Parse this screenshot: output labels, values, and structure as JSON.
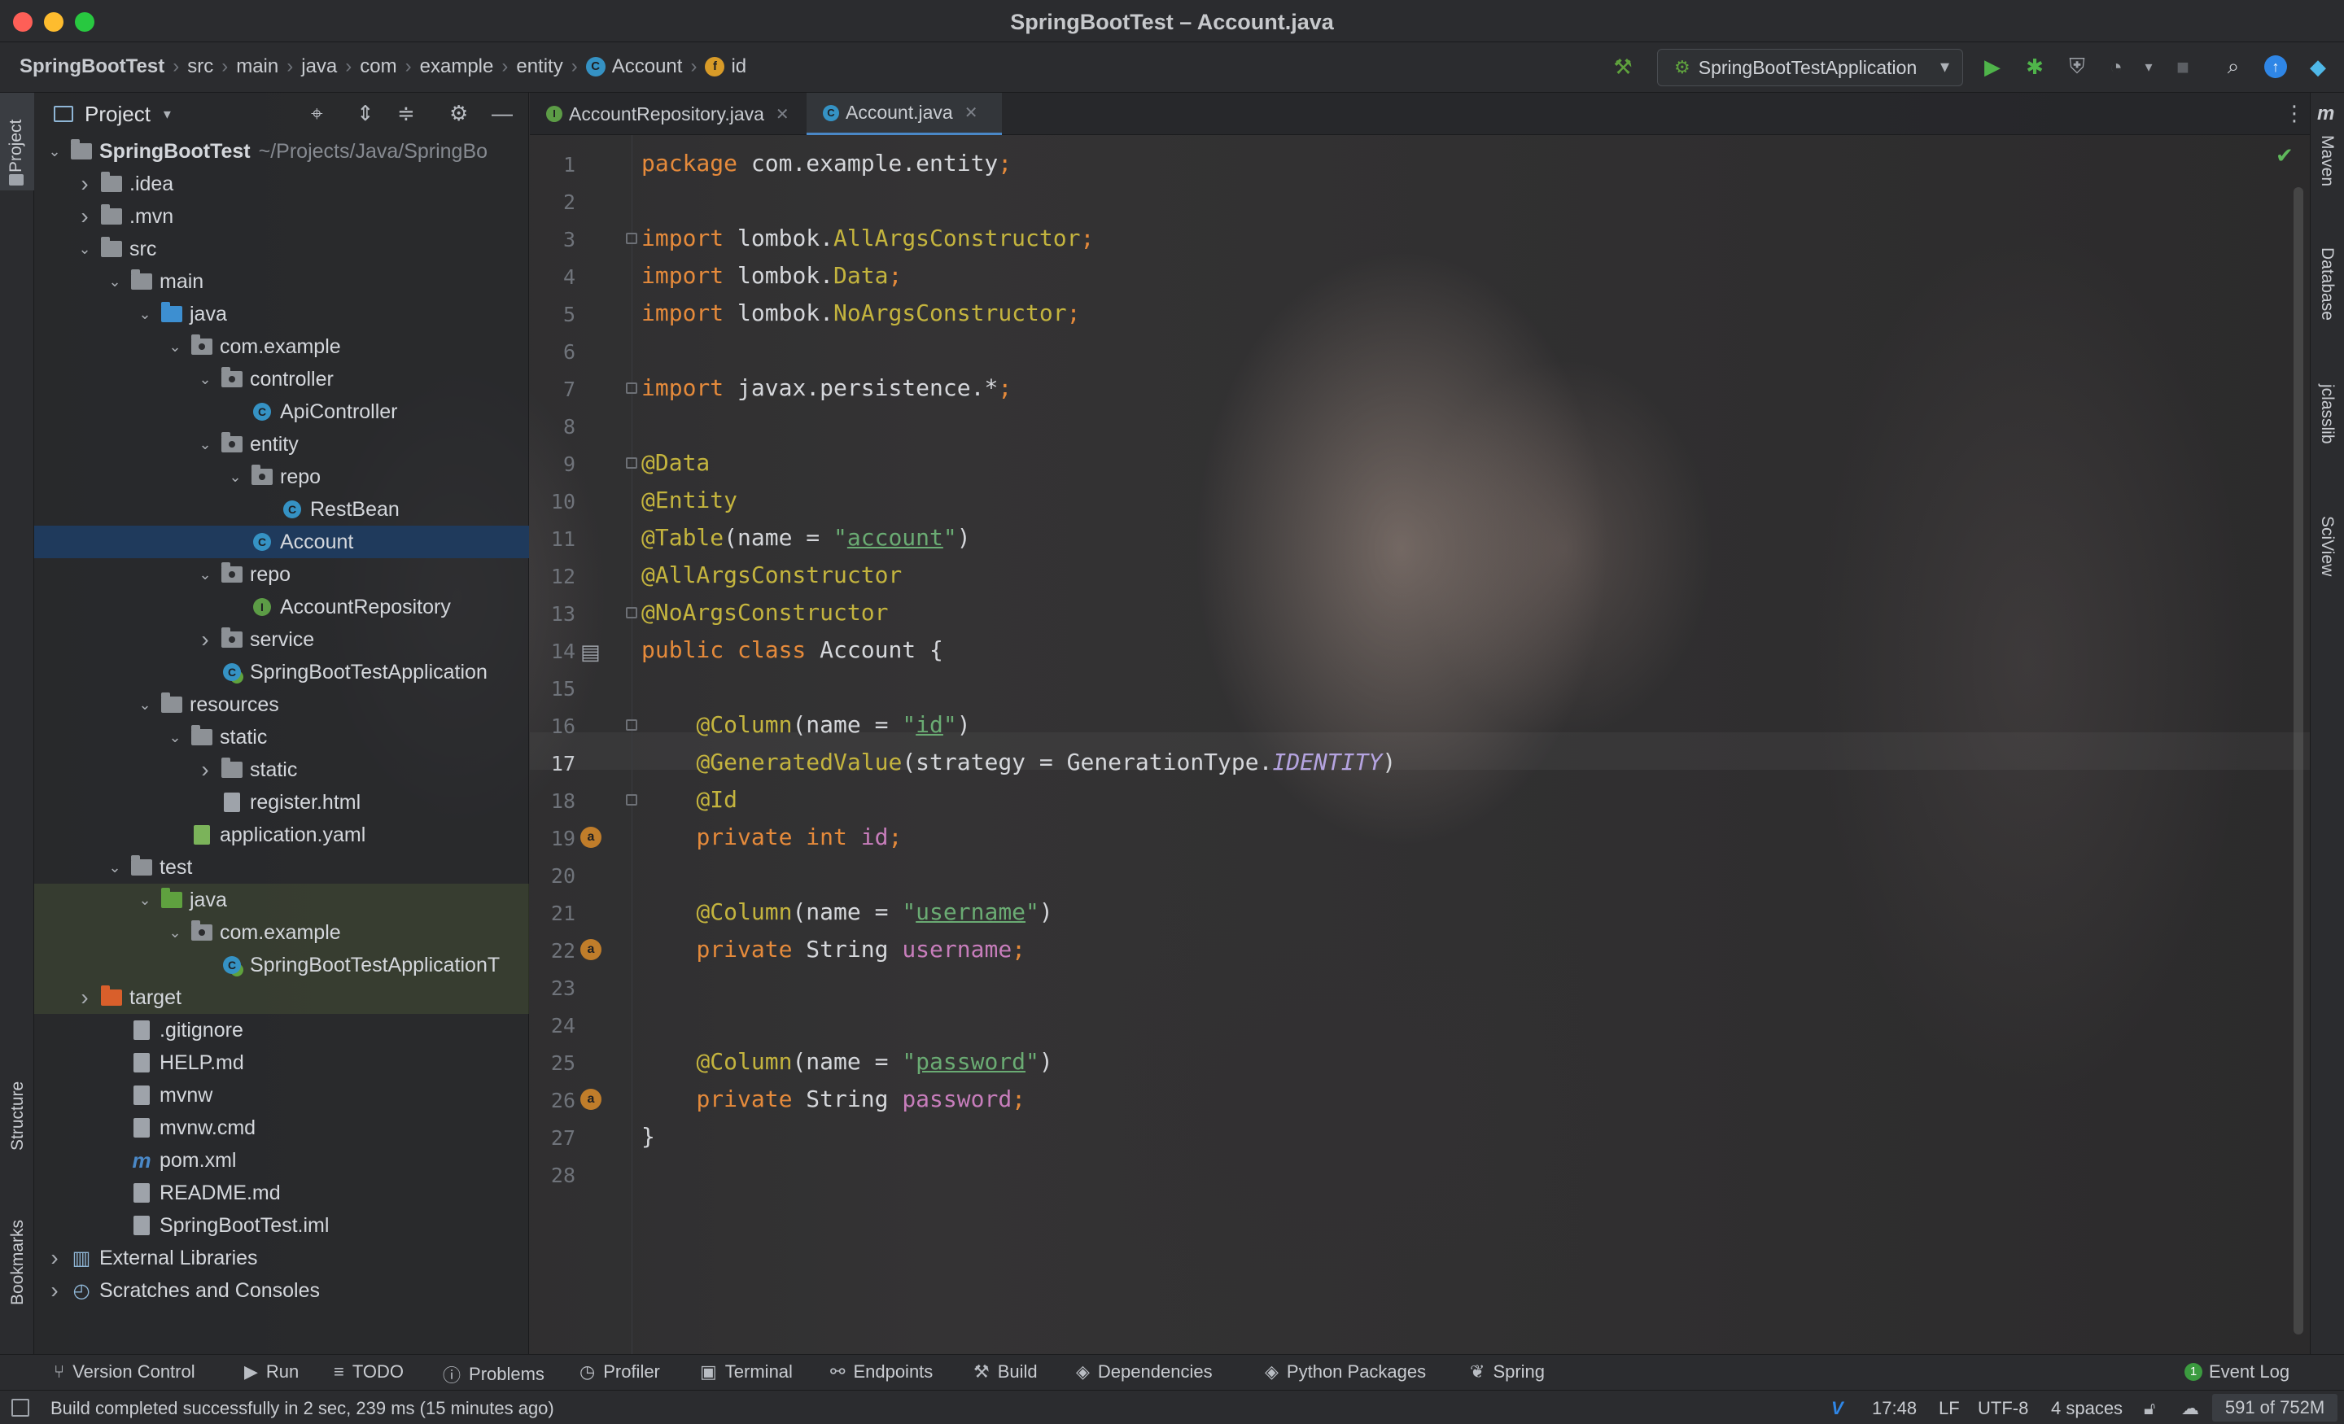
{
  "window": {
    "title": "SpringBootTest – Account.java"
  },
  "breadcrumb": [
    "SpringBootTest",
    "src",
    "main",
    "java",
    "com",
    "example",
    "entity",
    "Account",
    "id"
  ],
  "toolbar": {
    "run_config": "SpringBootTestApplication"
  },
  "left_stripe": {
    "project": "Project",
    "structure": "Structure",
    "bookmarks": "Bookmarks"
  },
  "right_stripe": {
    "maven": "Maven",
    "database": "Database",
    "jclasslib": "jclasslib",
    "sciview": "SciView"
  },
  "project_panel": {
    "title": "Project",
    "tree": [
      {
        "label": "SpringBootTest",
        "hint": "~/Projects/Java/SpringBo",
        "depth": 0,
        "arrow": "v",
        "icon": "folder",
        "bold": true
      },
      {
        "label": ".idea",
        "depth": 1,
        "arrow": ">",
        "icon": "folder"
      },
      {
        "label": ".mvn",
        "depth": 1,
        "arrow": ">",
        "icon": "folder"
      },
      {
        "label": "src",
        "depth": 1,
        "arrow": "v",
        "icon": "folder"
      },
      {
        "label": "main",
        "depth": 2,
        "arrow": "v",
        "icon": "folder"
      },
      {
        "label": "java",
        "depth": 3,
        "arrow": "v",
        "icon": "folder-blue"
      },
      {
        "label": "com.example",
        "depth": 4,
        "arrow": "v",
        "icon": "package"
      },
      {
        "label": "controller",
        "depth": 5,
        "arrow": "v",
        "icon": "package"
      },
      {
        "label": "ApiController",
        "depth": 6,
        "arrow": "",
        "icon": "class"
      },
      {
        "label": "entity",
        "depth": 5,
        "arrow": "v",
        "icon": "package"
      },
      {
        "label": "repo",
        "depth": 6,
        "arrow": "v",
        "icon": "package"
      },
      {
        "label": "RestBean",
        "depth": 7,
        "arrow": "",
        "icon": "class"
      },
      {
        "label": "Account",
        "depth": 6,
        "arrow": "",
        "icon": "class",
        "selected": true
      },
      {
        "label": "repo",
        "depth": 5,
        "arrow": "v",
        "icon": "package"
      },
      {
        "label": "AccountRepository",
        "depth": 6,
        "arrow": "",
        "icon": "interface"
      },
      {
        "label": "service",
        "depth": 5,
        "arrow": ">",
        "icon": "package"
      },
      {
        "label": "SpringBootTestApplication",
        "depth": 5,
        "arrow": "",
        "icon": "spring-class"
      },
      {
        "label": "resources",
        "depth": 3,
        "arrow": "v",
        "icon": "folder"
      },
      {
        "label": "static",
        "depth": 4,
        "arrow": "v",
        "icon": "folder"
      },
      {
        "label": "static",
        "depth": 5,
        "arrow": ">",
        "icon": "folder"
      },
      {
        "label": "register.html",
        "depth": 5,
        "arrow": "",
        "icon": "file"
      },
      {
        "label": "application.yaml",
        "depth": 4,
        "arrow": "",
        "icon": "file-yaml"
      },
      {
        "label": "test",
        "depth": 2,
        "arrow": "v",
        "icon": "folder"
      },
      {
        "label": "java",
        "depth": 3,
        "arrow": "v",
        "icon": "folder-green",
        "test": true
      },
      {
        "label": "com.example",
        "depth": 4,
        "arrow": "v",
        "icon": "package",
        "test": true
      },
      {
        "label": "SpringBootTestApplicationT",
        "depth": 5,
        "arrow": "",
        "icon": "spring-class",
        "test": true
      },
      {
        "label": "target",
        "depth": 1,
        "arrow": ">",
        "icon": "folder-orange",
        "test": true
      },
      {
        "label": ".gitignore",
        "depth": 2,
        "arrow": "",
        "icon": "file"
      },
      {
        "label": "HELP.md",
        "depth": 2,
        "arrow": "",
        "icon": "file"
      },
      {
        "label": "mvnw",
        "depth": 2,
        "arrow": "",
        "icon": "file"
      },
      {
        "label": "mvnw.cmd",
        "depth": 2,
        "arrow": "",
        "icon": "file"
      },
      {
        "label": "pom.xml",
        "depth": 2,
        "arrow": "",
        "icon": "file-maven"
      },
      {
        "label": "README.md",
        "depth": 2,
        "arrow": "",
        "icon": "file"
      },
      {
        "label": "SpringBootTest.iml",
        "depth": 2,
        "arrow": "",
        "icon": "file"
      },
      {
        "label": "External Libraries",
        "depth": 0,
        "arrow": ">",
        "icon": "libraries"
      },
      {
        "label": "Scratches and Consoles",
        "depth": 0,
        "arrow": ">",
        "icon": "scratches"
      }
    ]
  },
  "editor": {
    "tabs": [
      {
        "label": "AccountRepository.java",
        "icon": "interface",
        "active": false
      },
      {
        "label": "Account.java",
        "icon": "class",
        "active": true
      }
    ],
    "current_line": 17,
    "lines": [
      [
        [
          "kw",
          "package "
        ],
        [
          "",
          "com.example.entity"
        ],
        [
          "kw",
          ";"
        ]
      ],
      [],
      [
        [
          "kw",
          "import "
        ],
        [
          "",
          "lombok."
        ],
        [
          "an",
          "AllArgsConstructor"
        ],
        [
          "kw",
          ";"
        ]
      ],
      [
        [
          "kw",
          "import "
        ],
        [
          "",
          "lombok."
        ],
        [
          "an",
          "Data"
        ],
        [
          "kw",
          ";"
        ]
      ],
      [
        [
          "kw",
          "import "
        ],
        [
          "",
          "lombok."
        ],
        [
          "an",
          "NoArgsConstructor"
        ],
        [
          "kw",
          ";"
        ]
      ],
      [],
      [
        [
          "kw",
          "import "
        ],
        [
          "",
          "javax.persistence.*"
        ],
        [
          "kw",
          ";"
        ]
      ],
      [],
      [
        [
          "an",
          "@Data"
        ]
      ],
      [
        [
          "an",
          "@Entity"
        ]
      ],
      [
        [
          "an",
          "@Table"
        ],
        [
          "",
          "(name = "
        ],
        [
          "str",
          "\""
        ],
        [
          "stru",
          "account"
        ],
        [
          "str",
          "\""
        ],
        [
          "",
          ")"
        ]
      ],
      [
        [
          "an",
          "@AllArgsConstructor"
        ]
      ],
      [
        [
          "an",
          "@NoArgsConstructor"
        ]
      ],
      [
        [
          "kw",
          "public class "
        ],
        [
          "",
          "Account {"
        ]
      ],
      [],
      [
        [
          "",
          "    "
        ],
        [
          "an",
          "@Column"
        ],
        [
          "",
          "(name = "
        ],
        [
          "str",
          "\""
        ],
        [
          "stru",
          "id"
        ],
        [
          "str",
          "\""
        ],
        [
          "",
          ")"
        ]
      ],
      [
        [
          "",
          "    "
        ],
        [
          "an",
          "@GeneratedValue"
        ],
        [
          "",
          "(strategy = GenerationType."
        ],
        [
          "it",
          "IDENTITY"
        ],
        [
          "",
          ")"
        ]
      ],
      [
        [
          "",
          "    "
        ],
        [
          "an",
          "@Id"
        ]
      ],
      [
        [
          "",
          "    "
        ],
        [
          "kw",
          "private int "
        ],
        [
          "fld",
          "id"
        ],
        [
          "kw",
          ";"
        ]
      ],
      [],
      [
        [
          "",
          "    "
        ],
        [
          "an",
          "@Column"
        ],
        [
          "",
          "(name = "
        ],
        [
          "str",
          "\""
        ],
        [
          "stru",
          "username"
        ],
        [
          "str",
          "\""
        ],
        [
          "",
          ")"
        ]
      ],
      [
        [
          "",
          "    "
        ],
        [
          "kw",
          "private "
        ],
        [
          "",
          "String "
        ],
        [
          "fld",
          "username"
        ],
        [
          "kw",
          ";"
        ]
      ],
      [],
      [],
      [
        [
          "",
          "    "
        ],
        [
          "an",
          "@Column"
        ],
        [
          "",
          "(name = "
        ],
        [
          "str",
          "\""
        ],
        [
          "stru",
          "password"
        ],
        [
          "str",
          "\""
        ],
        [
          "",
          ")"
        ]
      ],
      [
        [
          "",
          "    "
        ],
        [
          "kw",
          "private "
        ],
        [
          "",
          "String "
        ],
        [
          "fld",
          "password"
        ],
        [
          "kw",
          ";"
        ]
      ],
      [
        [
          "",
          "}"
        ]
      ],
      []
    ],
    "gutter_marks": [
      {
        "line": 14,
        "symbol": "db-icon"
      },
      {
        "line": 19,
        "symbol": "a"
      },
      {
        "line": 22,
        "symbol": "a"
      },
      {
        "line": 26,
        "symbol": "a"
      }
    ]
  },
  "tool_windows": [
    {
      "label": "Version Control",
      "icon": "branch-icon"
    },
    {
      "label": "Run",
      "icon": "play-icon"
    },
    {
      "label": "TODO",
      "icon": "list-icon"
    },
    {
      "label": "Problems",
      "icon": "info-icon"
    },
    {
      "label": "Profiler",
      "icon": "profiler-icon"
    },
    {
      "label": "Terminal",
      "icon": "terminal-icon"
    },
    {
      "label": "Endpoints",
      "icon": "endpoints-icon"
    },
    {
      "label": "Build",
      "icon": "hammer-icon"
    },
    {
      "label": "Dependencies",
      "icon": "layers-icon"
    },
    {
      "label": "Python Packages",
      "icon": "layers-icon"
    },
    {
      "label": "Spring",
      "icon": "spring-icon"
    }
  ],
  "event_log": {
    "label": "Event Log",
    "count": "1"
  },
  "status": {
    "message": "Build completed successfully in 2 sec, 239 ms (15 minutes ago)",
    "time": "17:48",
    "line_sep": "LF",
    "encoding": "UTF-8",
    "indent": "4 spaces",
    "memory": "591 of 752M"
  },
  "colors": {
    "accent": "#4a88c7",
    "keyword": "#e58a3b",
    "annotation": "#c4b43e",
    "string": "#6aab73",
    "field": "#c77dbb"
  }
}
